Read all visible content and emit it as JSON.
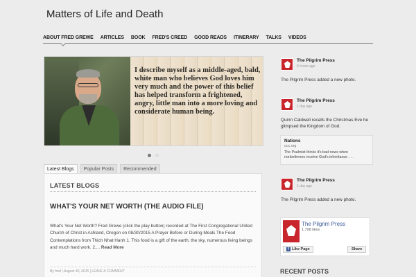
{
  "site": {
    "title": "Matters of Life and Death"
  },
  "nav": {
    "items": [
      {
        "label": "ABOUT FRED GREWE"
      },
      {
        "label": "ARTICLES"
      },
      {
        "label": "BOOK"
      },
      {
        "label": "FRED'S CREED"
      },
      {
        "label": "GOOD READS"
      },
      {
        "label": "ITINERARY"
      },
      {
        "label": "TALKS"
      },
      {
        "label": "VIDEOS"
      }
    ]
  },
  "slider": {
    "quote": "I describe myself as a middle-aged, bald, white man who believes God loves him very much and the power of this belief has helped transform a frightened, angry, little man into a more loving and considerate human being."
  },
  "tabs": [
    {
      "label": "Latest Blogs"
    },
    {
      "label": "Popular Posts"
    },
    {
      "label": "Recommended"
    }
  ],
  "latest": {
    "heading": "LATEST BLOGS",
    "post_title": "WHAT'S YOUR NET WORTH (THE AUDIO FILE)",
    "post_body": "What's Your Net Worth? Fred Grewe (click the play button) recorded at The First Congregational United Church of Christ in Ashland, Oregon on 08/30/2015  A Prayer Before or During Meals The Food Contemplations from Thich Nhat Hanh  1. This food is a gift of the earth, the sky, numerous living beings and much hard work.  2.... ",
    "read_more": "Read More",
    "byline": "By fred | August 30, 2015 | LEAVE A COMMENT"
  },
  "sidebar": {
    "feed": [
      {
        "name": "The Pilgrim Press",
        "time": "6 hours ago",
        "text": "The Pilgrim Press  added a new photo."
      },
      {
        "name": "The Pilgrim Press",
        "time": "1 day ago",
        "text": "Quinn Caldwell recalls the Christmas Eve he glimpsed the Kingdom of God."
      },
      {
        "name": "The Pilgrim Press",
        "time": "1 day ago",
        "text": "The Pilgrim Press  added a new photo."
      }
    ],
    "nations": {
      "title": "Nations",
      "source": "ucc.org",
      "desc": "The Psalmist thinks it's bad news when nonbelievers receive God's inheritance . . ."
    },
    "facebook": {
      "page_name": "The Pilgrim Press",
      "likes": "1,798 likes",
      "like_label": "Like Page",
      "share_label": "Share"
    },
    "recent_heading": "RECENT POSTS"
  }
}
